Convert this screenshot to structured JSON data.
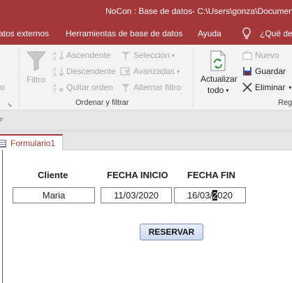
{
  "window": {
    "title": "NoCon : Base de datos- C:\\Users\\gonza\\Documents"
  },
  "menu": {
    "items": [
      "atos externos",
      "Herramientas de base de datos",
      "Ayuda"
    ],
    "tell_me": "¿Qué des"
  },
  "ribbon": {
    "filter_label": "Filtro",
    "sort": {
      "ascending": "Ascendente",
      "descending": "Descendente",
      "clear": "Quitar orden"
    },
    "selection": {
      "selection": "Selección",
      "advanced": "Avanzadas",
      "toggle": "Alternar filtro"
    },
    "group_sort_filter": "Ordenar y filtrar",
    "refresh": {
      "line1": "Actualizar",
      "line2": "todo"
    },
    "records": {
      "new": "Nuevo",
      "save": "Guardar",
      "delete": "Eliminar"
    },
    "group_records": "Reg",
    "partial_left": "o"
  },
  "tab": {
    "label": "Formulario1"
  },
  "form": {
    "headers": {
      "client": "Cliente",
      "start": "FECHA INICIO",
      "end": "FECHA FIN"
    },
    "values": {
      "client": "Maria",
      "start": "11/03/2020",
      "end_before": "16/03/",
      "end_caret": "2",
      "end_after": "020"
    },
    "reserve_button": "RESERVAR"
  },
  "colors": {
    "accent": "#a4373a",
    "ribbon_bg": "#f3f3f3",
    "button_bg": "#cdd9f1"
  }
}
